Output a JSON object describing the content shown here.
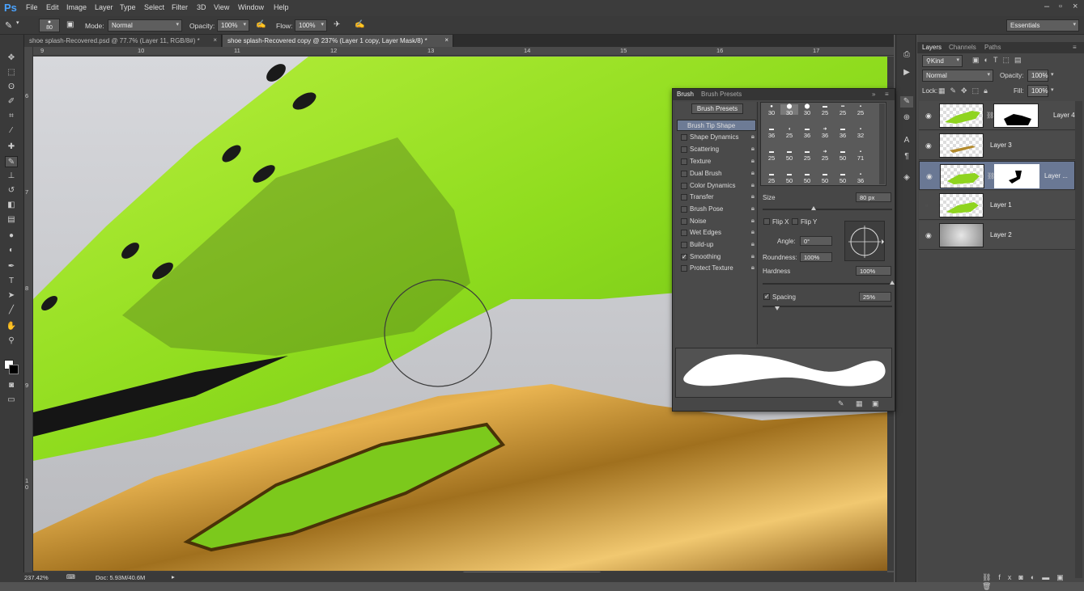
{
  "menubar": {
    "logo": "Ps",
    "items": [
      "File",
      "Edit",
      "Image",
      "Layer",
      "Type",
      "Select",
      "Filter",
      "3D",
      "View",
      "Window",
      "Help"
    ]
  },
  "options": {
    "brush_size": "80",
    "mode_label": "Mode:",
    "mode_value": "Normal",
    "opacity_label": "Opacity:",
    "opacity_value": "100%",
    "flow_label": "Flow:",
    "flow_value": "100%",
    "workspace": "Essentials"
  },
  "doc_tabs": [
    {
      "label": "shoe splash-Recovered.psd @ 77.7% (Layer 11, RGB/8#) *",
      "close": "×"
    },
    {
      "label": "shoe splash-Recovered copy @ 237% (Layer 1 copy, Layer Mask/8) *",
      "close": "×"
    }
  ],
  "ruler_h": [
    "9",
    "10",
    "11",
    "12",
    "13",
    "14",
    "15",
    "16",
    "17"
  ],
  "ruler_v": [
    "6",
    "7",
    "8",
    "9",
    "1 0"
  ],
  "status": {
    "zoom": "237.42%",
    "doc": "Doc: 5.93M/40.6M"
  },
  "brush_panel": {
    "tabs": [
      "Brush",
      "Brush Presets"
    ],
    "presets_button": "Brush Presets",
    "items": [
      {
        "label": "Brush Tip Shape",
        "checked": null,
        "selected": true
      },
      {
        "label": "Shape Dynamics",
        "checked": false
      },
      {
        "label": "Scattering",
        "checked": false
      },
      {
        "label": "Texture",
        "checked": false
      },
      {
        "label": "Dual Brush",
        "checked": false
      },
      {
        "label": "Color Dynamics",
        "checked": false
      },
      {
        "label": "Transfer",
        "checked": false
      },
      {
        "label": "Brush Pose",
        "checked": false
      },
      {
        "label": "Noise",
        "checked": false
      },
      {
        "label": "Wet Edges",
        "checked": false
      },
      {
        "label": "Build-up",
        "checked": false
      },
      {
        "label": "Smoothing",
        "checked": true
      },
      {
        "label": "Protect Texture",
        "checked": false
      }
    ],
    "tip_sizes": [
      [
        "30",
        "30",
        "30",
        "25",
        "25",
        "25"
      ],
      [
        "36",
        "25",
        "36",
        "36",
        "36",
        "32"
      ],
      [
        "25",
        "50",
        "25",
        "25",
        "50",
        "71"
      ],
      [
        "25",
        "50",
        "50",
        "50",
        "50",
        "36"
      ]
    ],
    "size_label": "Size",
    "size_value": "80 px",
    "flip_x": "Flip X",
    "flip_y": "Flip Y",
    "angle_label": "Angle:",
    "angle_value": "0°",
    "roundness_label": "Roundness:",
    "roundness_value": "100%",
    "hardness_label": "Hardness",
    "hardness_value": "100%",
    "spacing_label": "Spacing",
    "spacing_value": "25%",
    "spacing_checked": true
  },
  "layers_panel": {
    "tabs": [
      "Layers",
      "Channels",
      "Paths"
    ],
    "kind": "Kind",
    "blend": "Normal",
    "opacity_label": "Opacity:",
    "opacity_value": "100%",
    "lock_label": "Lock:",
    "fill_label": "Fill:",
    "fill_value": "100%",
    "layers": [
      {
        "name": "Layer 4",
        "visible": true,
        "mask": true,
        "selected": false
      },
      {
        "name": "Layer 3",
        "visible": true,
        "mask": false,
        "selected": false
      },
      {
        "name": "Layer ...",
        "visible": true,
        "mask": true,
        "selected": true
      },
      {
        "name": "Layer 1",
        "visible": false,
        "mask": false,
        "selected": false
      },
      {
        "name": "Layer 2",
        "visible": true,
        "mask": false,
        "selected": false
      }
    ]
  }
}
